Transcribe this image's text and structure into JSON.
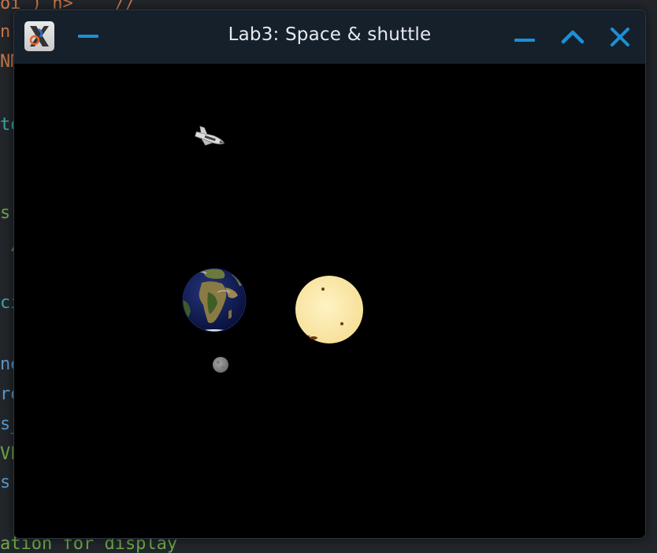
{
  "window": {
    "title": "Lab3: Space & shuttle",
    "icon": "x11-logo-icon",
    "controls": [
      "menu-minimize-icon",
      "minimize-icon",
      "maximize-icon",
      "close-icon"
    ]
  },
  "background_code": [
    {
      "text": "oi ) n>    //",
      "color": "#c8784a"
    },
    {
      "text": "n'",
      "color": "#c8784a"
    },
    {
      "text": "NM",
      "color": "#c8784a"
    },
    {
      "text": "to",
      "color": "#3ea6a6"
    },
    {
      "text": "s",
      "color": "#6fa84a"
    },
    {
      "text": " /",
      "color": "#6fa84a"
    },
    {
      "text": "ci",
      "color": "#3ea6a6"
    },
    {
      "text": "ne",
      "color": "#5a9bd0"
    },
    {
      "text": "ro",
      "color": "#5a9bd0"
    },
    {
      "text": "s_",
      "color": "#5a9bd0"
    },
    {
      "text": "VE",
      "color": "#6fa84a"
    },
    {
      "text": "s",
      "color": "#5a9bd0"
    },
    {
      "text": "ation for display",
      "color": "#6fa84a"
    }
  ],
  "scene": {
    "objects": [
      "space-shuttle",
      "earth",
      "moon",
      "sun"
    ]
  },
  "colors": {
    "titlebar": "#15202b",
    "title_text": "#e6e9ee",
    "control_blue": "#1d8fd6",
    "sun": "#fde9a6",
    "moon": "#8a8a8a",
    "space": "#000000"
  }
}
